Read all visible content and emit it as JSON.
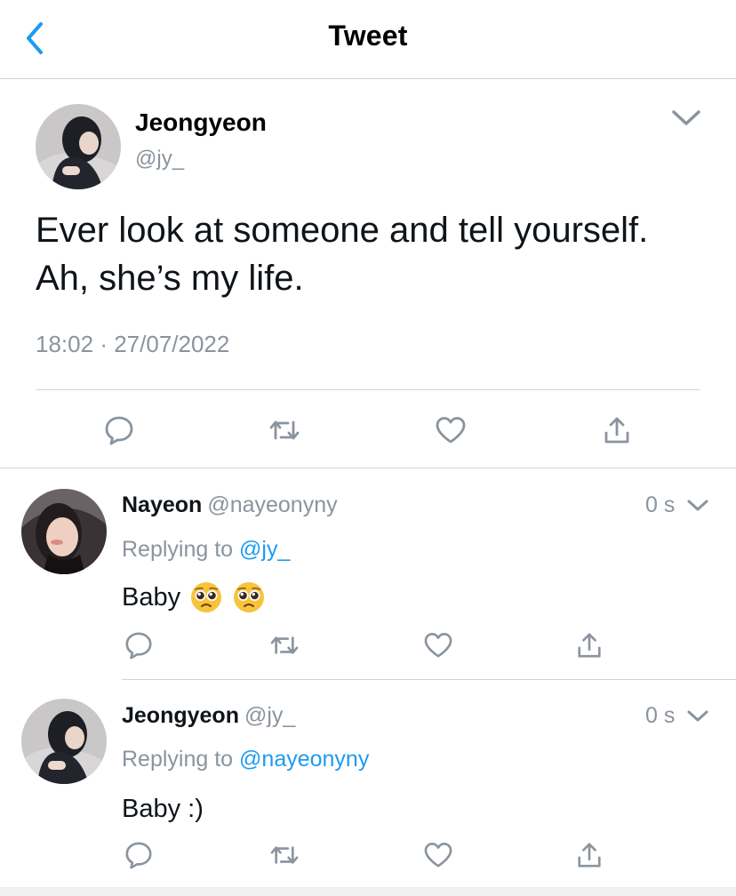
{
  "header": {
    "title": "Tweet",
    "back_icon": "chevron-left-icon"
  },
  "colors": {
    "accent": "#1d9bf0",
    "secondary_text": "#8a949e",
    "divider": "#cfd4d9"
  },
  "main_tweet": {
    "author_name": "Jeongyeon",
    "author_handle": "@jy_",
    "text_lines": [
      "Ever look at someone and tell yourself.",
      "Ah, she’s my life."
    ],
    "time": "18:02",
    "separator": "·",
    "date": "27/07/2022",
    "actions": [
      "reply-icon",
      "retweet-icon",
      "like-icon",
      "share-icon"
    ]
  },
  "replies": [
    {
      "author_name": "Nayeon",
      "author_handle": "@nayeonyny",
      "time": "0 s",
      "replying_prefix": "Replying to",
      "replying_to": "@jy_",
      "text": "Baby",
      "emojis": [
        "pleading-face-emoji",
        "pleading-face-emoji"
      ]
    },
    {
      "author_name": "Jeongyeon",
      "author_handle": "@jy_",
      "time": "0 s",
      "replying_prefix": "Replying to",
      "replying_to": "@nayeonyny",
      "text": "Baby :)",
      "emojis": []
    }
  ]
}
